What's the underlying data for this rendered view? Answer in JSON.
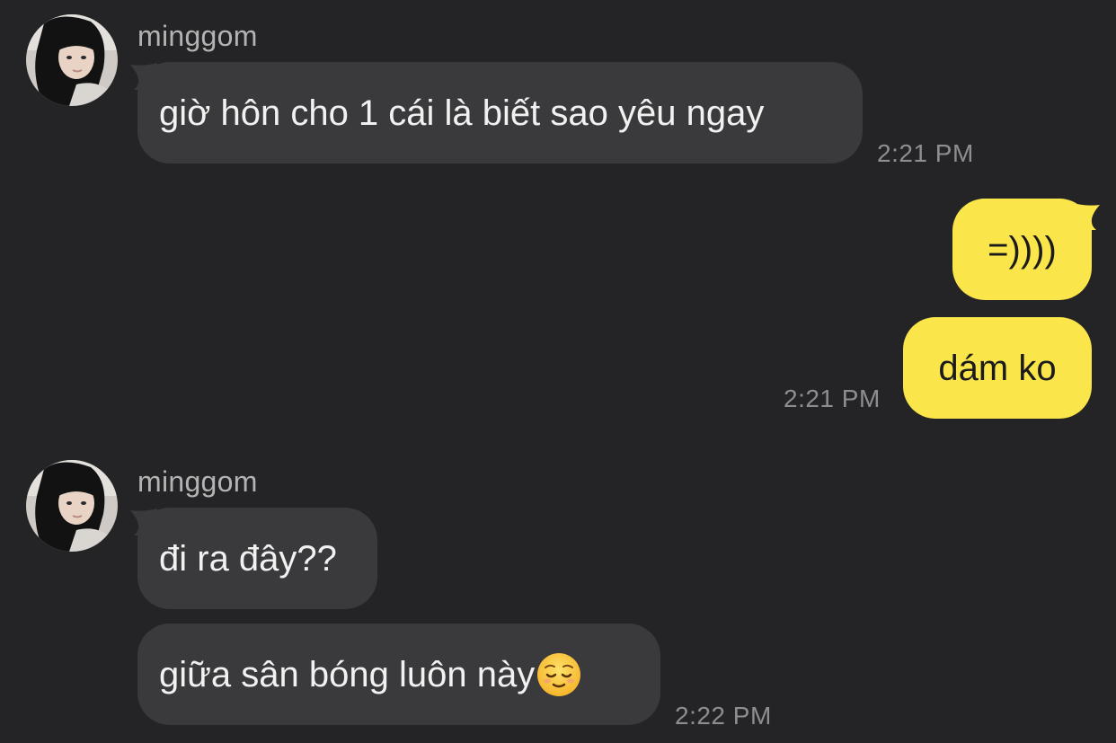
{
  "colors": {
    "background": "#242426",
    "incoming_bubble": "#3a3a3c",
    "outgoing_bubble": "#fae54b",
    "sender_text": "#b3b3b3",
    "timestamp_text": "#8e8e90"
  },
  "chat": {
    "group1": {
      "sender": "minggom",
      "avatar_icon": "profile-photo",
      "messages": [
        {
          "text": "giờ hôn cho 1 cái là biết sao yêu ngay"
        }
      ],
      "time": "2:21 PM"
    },
    "group2": {
      "messages": [
        {
          "text": "=))))"
        },
        {
          "text": "dám ko"
        }
      ],
      "time": "2:21 PM"
    },
    "group3": {
      "sender": "minggom",
      "avatar_icon": "profile-photo",
      "messages": [
        {
          "text": "đi ra đây??"
        },
        {
          "text": "giữa sân bóng luôn này",
          "emoji": "relieved-face-emoji"
        }
      ],
      "time": "2:22 PM"
    }
  }
}
